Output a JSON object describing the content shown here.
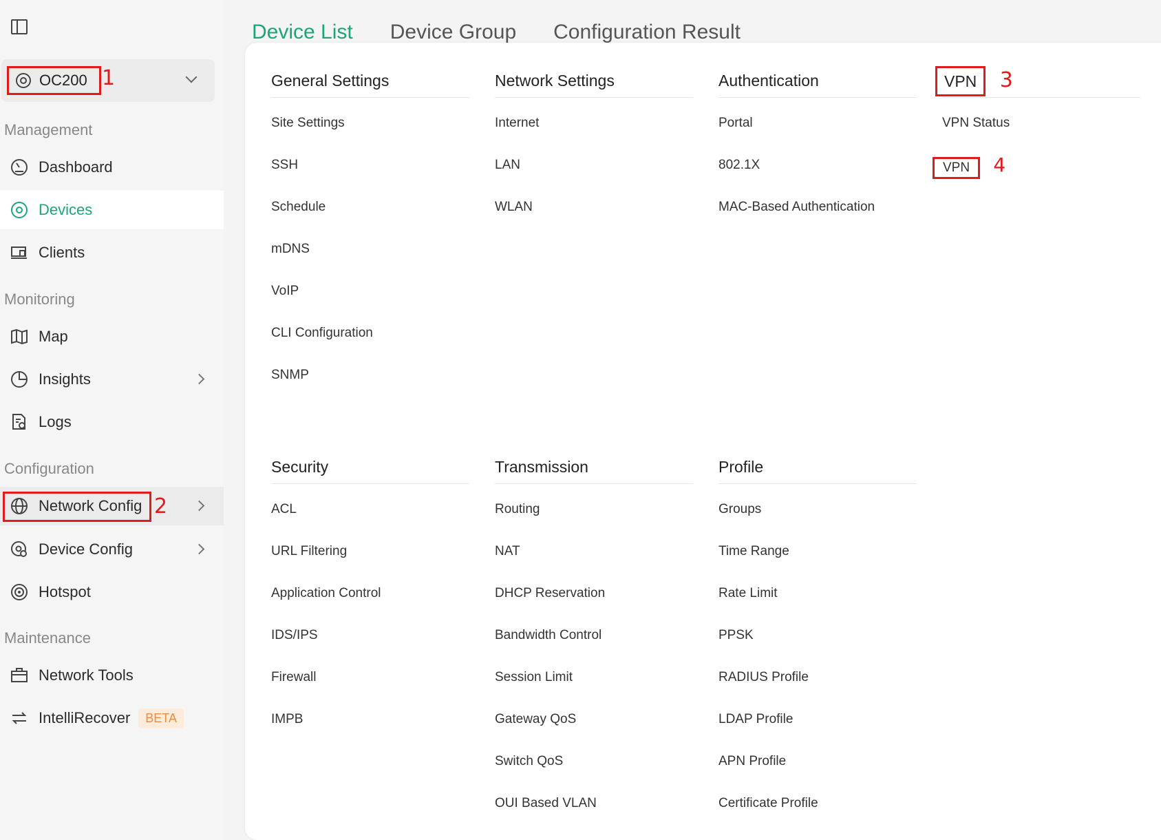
{
  "site": {
    "name": "OC200"
  },
  "annotations": {
    "n1": "1",
    "n2": "2",
    "n3": "3",
    "n4": "4"
  },
  "sidebar": {
    "sections": {
      "management": "Management",
      "monitoring": "Monitoring",
      "configuration": "Configuration",
      "maintenance": "Maintenance"
    },
    "items": {
      "dashboard": "Dashboard",
      "devices": "Devices",
      "clients": "Clients",
      "map": "Map",
      "insights": "Insights",
      "logs": "Logs",
      "network_config": "Network Config",
      "device_config": "Device Config",
      "hotspot": "Hotspot",
      "network_tools": "Network Tools",
      "intellirecover": "IntelliRecover",
      "beta": "BETA"
    }
  },
  "tabs": [
    "Device List",
    "Device Group",
    "Configuration Result"
  ],
  "menu": {
    "general": {
      "title": "General Settings",
      "items": [
        "Site Settings",
        "SSH",
        "Schedule",
        "mDNS",
        "VoIP",
        "CLI Configuration",
        "SNMP"
      ]
    },
    "network": {
      "title": "Network Settings",
      "items": [
        "Internet",
        "LAN",
        "WLAN"
      ]
    },
    "auth": {
      "title": "Authentication",
      "items": [
        "Portal",
        "802.1X",
        "MAC-Based Authentication"
      ]
    },
    "vpn": {
      "title": "VPN",
      "items": [
        "VPN Status",
        "VPN"
      ]
    },
    "security": {
      "title": "Security",
      "items": [
        "ACL",
        "URL Filtering",
        "Application Control",
        "IDS/IPS",
        "Firewall",
        "IMPB"
      ]
    },
    "transmission": {
      "title": "Transmission",
      "items": [
        "Routing",
        "NAT",
        "DHCP Reservation",
        "Bandwidth Control",
        "Session Limit",
        "Gateway QoS",
        "Switch QoS",
        "OUI Based VLAN"
      ]
    },
    "profile": {
      "title": "Profile",
      "items": [
        "Groups",
        "Time Range",
        "Rate Limit",
        "PPSK",
        "RADIUS Profile",
        "LDAP Profile",
        "APN Profile",
        "Certificate Profile"
      ]
    }
  },
  "colors": {
    "accent": "#1aa67a",
    "annotation": "#e01b1b",
    "beta_text": "#f08a3c"
  }
}
